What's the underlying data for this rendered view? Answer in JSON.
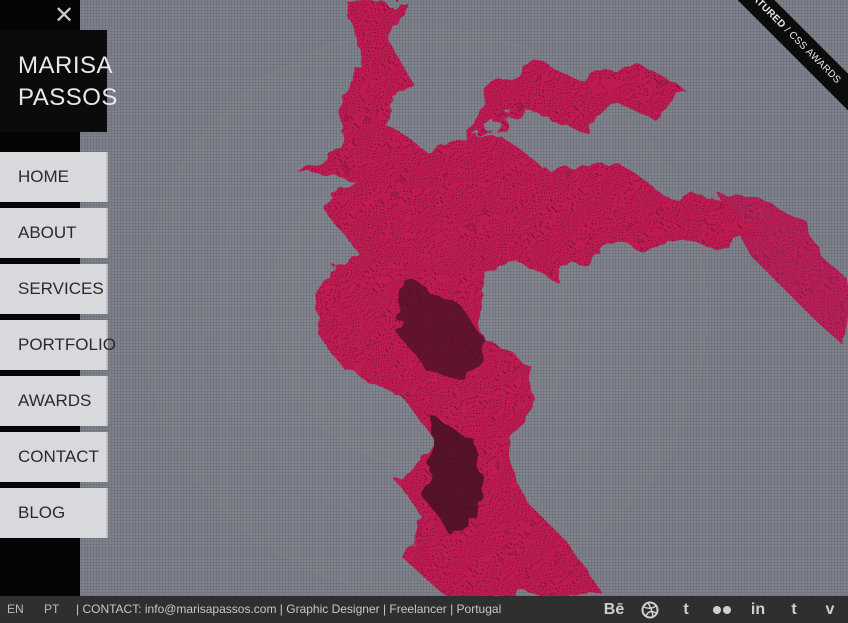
{
  "logo": {
    "line1": "MARISA",
    "line2": "PASSOS"
  },
  "close": {
    "glyph": "✕"
  },
  "nav": {
    "items": [
      {
        "label": "HOME"
      },
      {
        "label": "ABOUT"
      },
      {
        "label": "SERVICES"
      },
      {
        "label": "PORTFOLIO"
      },
      {
        "label": "AWARDS"
      },
      {
        "label": "CONTACT"
      },
      {
        "label": "BLOG"
      }
    ]
  },
  "ribbon": {
    "featured": "FEATURED",
    "sep": " / ",
    "source": "CSS AWARDS"
  },
  "footer": {
    "lang_en": "EN",
    "lang_pt": "PT",
    "text": "| CONTACT: info@marisapassos.com   | Graphic Designer | Freelancer | Portugal"
  },
  "socials": {
    "behance": "Bē",
    "twitter": "t",
    "linkedin": "in",
    "tumblr": "t",
    "vimeo": "v"
  },
  "colors": {
    "accent_magenta": "#c2124f",
    "nav_bg": "#d8d9dd",
    "sidebar_bg": "#050505",
    "footer_bg": "#2f2f2f"
  }
}
